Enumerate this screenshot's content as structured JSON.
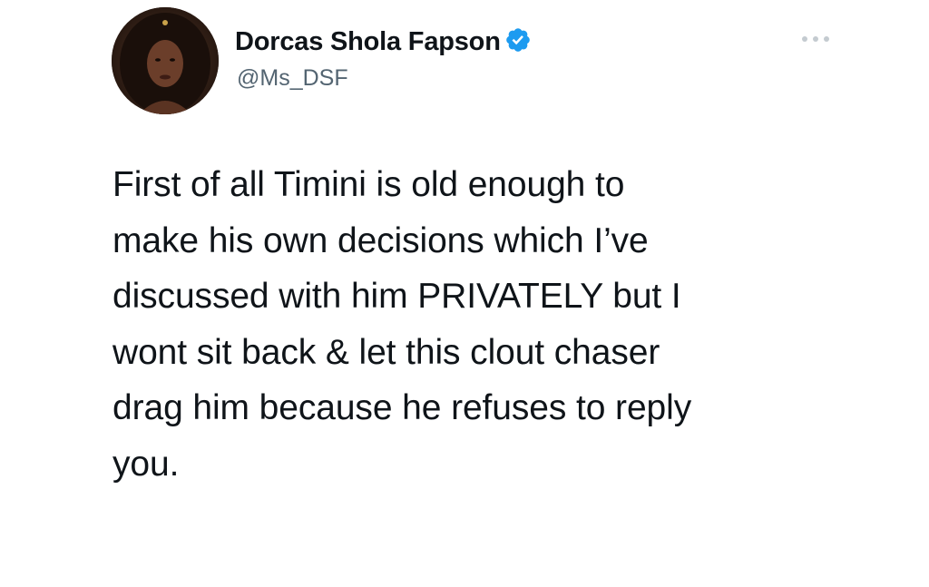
{
  "author": {
    "display_name": "Dorcas Shola Fapson",
    "handle": "@Ms_DSF",
    "verified": true,
    "avatar_icon": "profile-photo"
  },
  "tweet": {
    "lines": [
      "First of all Timini is old enough to",
      "make his own decisions which I’ve",
      "discussed with him PRIVATELY but I",
      "wont sit back & let this clout chaser",
      "drag him because he refuses to reply",
      "you."
    ]
  },
  "icons": {
    "more": "more-options-icon",
    "verified": "verified-badge-icon"
  },
  "colors": {
    "text": "#0f1419",
    "secondary_text": "#536471",
    "verified_blue": "#1d9bf0",
    "background": "#ffffff"
  }
}
